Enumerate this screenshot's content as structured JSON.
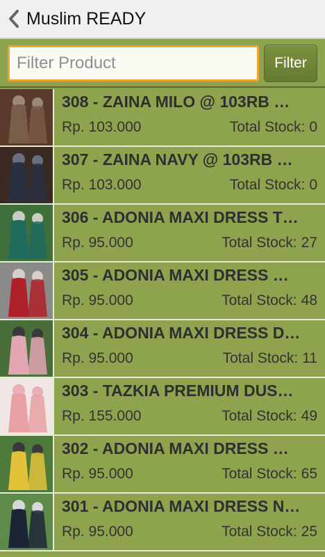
{
  "header": {
    "title": "Muslim READY",
    "back_icon": "chevron-left-icon"
  },
  "filter": {
    "placeholder": "Filter Product",
    "value": "",
    "button_label": "Filter",
    "accent": "#f0a335"
  },
  "stock_label": "Total Stock:",
  "products": [
    {
      "title": "308 - ZAINA MILO @ 103RB …",
      "price": "Rp. 103.000",
      "stock": "0",
      "img": {
        "bg": "#5a3a2a",
        "dress": "#7a5c4a",
        "hijab": "#9b8a7a"
      }
    },
    {
      "title": "307 - ZAINA NAVY @ 103RB …",
      "price": "Rp. 103.000",
      "stock": "0",
      "img": {
        "bg": "#3a2a22",
        "dress": "#2a3040",
        "hijab": "#6a6f80"
      }
    },
    {
      "title": "306 - ADONIA MAXI DRESS T…",
      "price": "Rp. 95.000",
      "stock": "27",
      "img": {
        "bg": "#3f6f3a",
        "dress": "#1f6b5e",
        "hijab": "#c9ccc0"
      }
    },
    {
      "title": "305 - ADONIA MAXI DRESS …",
      "price": "Rp. 95.000",
      "stock": "48",
      "img": {
        "bg": "#8a8a88",
        "dress": "#b0202a",
        "hijab": "#d8d0c8"
      }
    },
    {
      "title": "304 - ADONIA MAXI DRESS D…",
      "price": "Rp. 95.000",
      "stock": "11",
      "img": {
        "bg": "#4a6e3a",
        "dress": "#e3a6b3",
        "hijab": "#3a3a3a"
      }
    },
    {
      "title": "303 - TAZKIA PREMIUM DUS…",
      "price": "Rp. 155.000",
      "stock": "49",
      "img": {
        "bg": "#f0e6e4",
        "dress": "#e9a0a4",
        "hijab": "#e6b0b4"
      }
    },
    {
      "title": "302 - ADONIA MAXI DRESS …",
      "price": "Rp. 95.000",
      "stock": "65",
      "img": {
        "bg": "#4e7a3c",
        "dress": "#e3c23a",
        "hijab": "#3a3a3a"
      }
    },
    {
      "title": "301 - ADONIA MAXI DRESS N…",
      "price": "Rp. 95.000",
      "stock": "25",
      "img": {
        "bg": "#5e8a4a",
        "dress": "#1c2438",
        "hijab": "#d8d8d8"
      }
    }
  ]
}
